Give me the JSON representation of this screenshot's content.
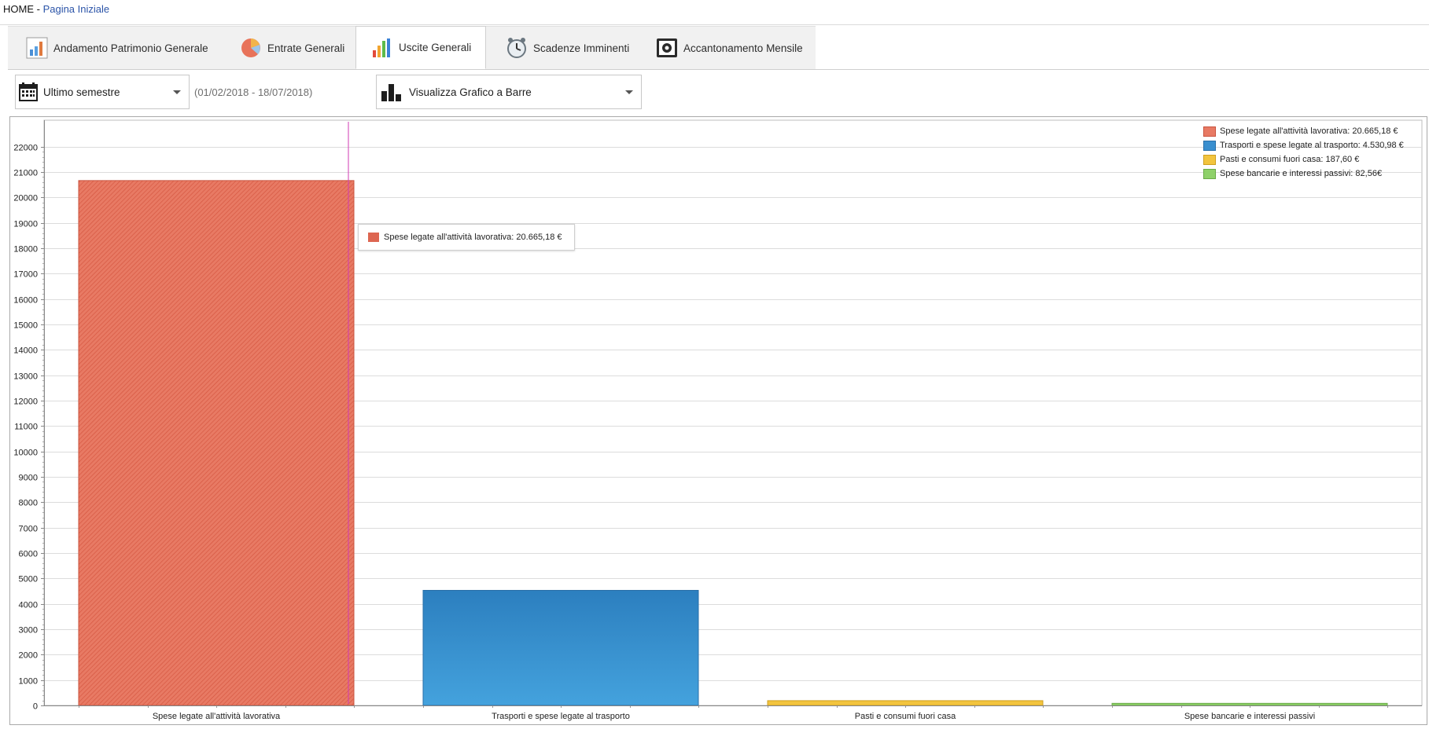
{
  "breadcrumb": {
    "home": "HOME",
    "separator": " - ",
    "current": "Pagina Iniziale"
  },
  "tabs": [
    {
      "label": "Andamento Patrimonio Generale",
      "icon": "trend-chart-icon",
      "active": false
    },
    {
      "label": "Entrate Generali",
      "icon": "pie-chart-icon",
      "active": false
    },
    {
      "label": "Uscite Generali",
      "icon": "bar-chart-icon",
      "active": true
    },
    {
      "label": "Scadenze Imminenti",
      "icon": "alarm-clock-icon",
      "active": false
    },
    {
      "label": "Accantonamento Mensile",
      "icon": "safe-icon",
      "active": false
    }
  ],
  "toolbar": {
    "period": {
      "value": "Ultimo semestre",
      "icon": "calendar-icon"
    },
    "date_range": "(01/02/2018 - 18/07/2018)",
    "view": {
      "value": "Visualizza Grafico a Barre",
      "icon": "bar-chart-view-icon"
    }
  },
  "chart_data": {
    "type": "bar",
    "categories": [
      "Spese legate all'attività lavorativa",
      "Trasporti e spese legate al trasporto",
      "Pasti e consumi fuori casa",
      "Spese bancarie e interessi passivi"
    ],
    "values": [
      20665.18,
      4530.98,
      187.6,
      82.56
    ],
    "colors": [
      "#dd6651",
      "#3a8fcf",
      "#f2c43e",
      "#8fd16a"
    ],
    "ylim": [
      0,
      22000
    ],
    "ytick_step": 1000,
    "grid": true,
    "legend_position": "top-right",
    "legend": [
      "Spese legate all'attività lavorativa: 20.665,18 €",
      "Trasporti e spese legate al trasporto: 4.530,98 €",
      "Pasti e consumi fuori casa: 187,60 €",
      "Spese bancarie e interessi passivi: 82,56€"
    ],
    "tooltip": "Spese legate all'attività lavorativa: 20.665,18 €"
  }
}
